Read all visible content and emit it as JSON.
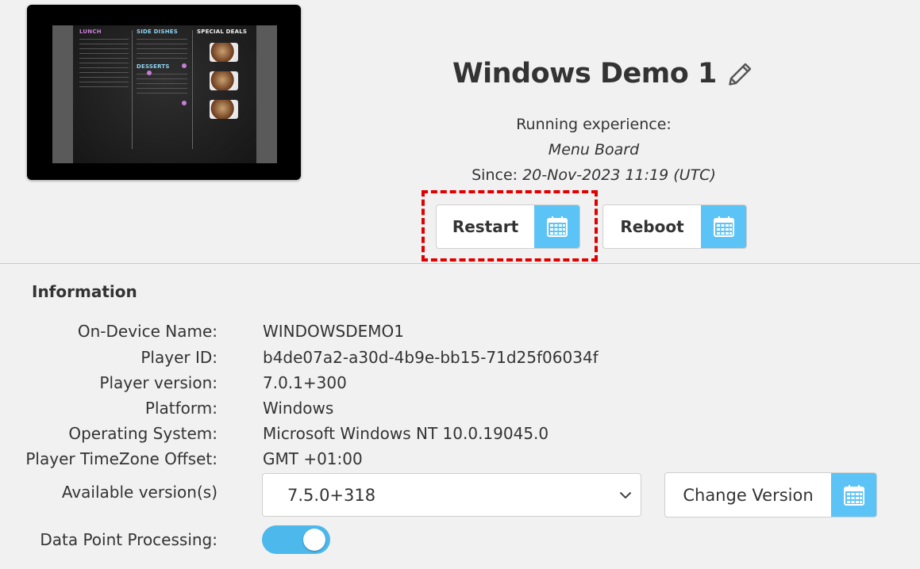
{
  "device": {
    "title": "Windows Demo 1",
    "running_label": "Running experience:",
    "experience_name": "Menu Board",
    "since_label": "Since:",
    "since_value": "20-Nov-2023 11:19 (UTC)"
  },
  "preview": {
    "menu_lunch": "LUNCH",
    "menu_side": "SIDE DISHES",
    "menu_deals": "SPECIAL DEALS",
    "menu_desserts": "DESSERTS"
  },
  "actions": {
    "restart_label": "Restart",
    "reboot_label": "Reboot"
  },
  "information": {
    "heading": "Information",
    "rows": [
      {
        "label": "On-Device Name:",
        "value": "WINDOWSDEMO1"
      },
      {
        "label": "Player ID:",
        "value": "b4de07a2-a30d-4b9e-bb15-71d25f06034f"
      },
      {
        "label": "Player version:",
        "value": "7.0.1+300"
      },
      {
        "label": "Platform:",
        "value": "Windows"
      },
      {
        "label": "Operating System:",
        "value": "Microsoft Windows NT 10.0.19045.0"
      },
      {
        "label": "Player TimeZone Offset:",
        "value": "GMT +01:00"
      }
    ],
    "available_label": "Available version(s)",
    "available_selected": "7.5.0+318",
    "change_version_label": "Change Version",
    "data_point_label": "Data Point Processing:",
    "data_point_enabled": true
  },
  "colors": {
    "accent": "#5bc3f5",
    "highlight": "#e00000",
    "background": "#f1f1f1"
  }
}
